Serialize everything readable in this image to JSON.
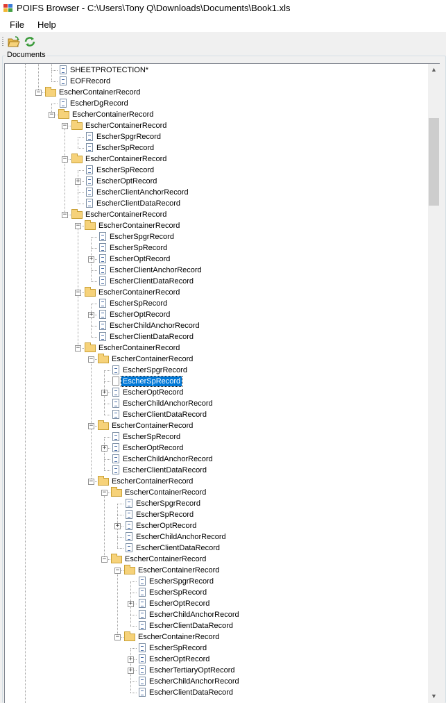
{
  "window": {
    "title": "POIFS Browser - C:\\Users\\Tony Q\\Downloads\\Documents\\Book1.xls"
  },
  "menu": {
    "file": "File",
    "help": "Help"
  },
  "toolbar": {
    "open": "open-folder-icon",
    "refresh": "refresh-icon"
  },
  "group": {
    "label": "Documents"
  },
  "tree": {
    "nodes": [
      {
        "label": "SHEETPROTECTION*",
        "depth": 3,
        "kind": "doc",
        "expander": ""
      },
      {
        "label": "EOFRecord",
        "depth": 3,
        "kind": "doc",
        "expander": ""
      },
      {
        "label": "EscherContainerRecord",
        "depth": 2,
        "kind": "folder",
        "expander": "-"
      },
      {
        "label": "EscherDgRecord",
        "depth": 3,
        "kind": "doc",
        "expander": ""
      },
      {
        "label": "EscherContainerRecord",
        "depth": 3,
        "kind": "folder",
        "expander": "-"
      },
      {
        "label": "EscherContainerRecord",
        "depth": 4,
        "kind": "folder",
        "expander": "-"
      },
      {
        "label": "EscherSpgrRecord",
        "depth": 5,
        "kind": "doc",
        "expander": ""
      },
      {
        "label": "EscherSpRecord",
        "depth": 5,
        "kind": "doc",
        "expander": ""
      },
      {
        "label": "EscherContainerRecord",
        "depth": 4,
        "kind": "folder",
        "expander": "-"
      },
      {
        "label": "EscherSpRecord",
        "depth": 5,
        "kind": "doc",
        "expander": ""
      },
      {
        "label": "EscherOptRecord",
        "depth": 5,
        "kind": "doc",
        "expander": "+"
      },
      {
        "label": "EscherClientAnchorRecord",
        "depth": 5,
        "kind": "doc",
        "expander": ""
      },
      {
        "label": "EscherClientDataRecord",
        "depth": 5,
        "kind": "doc",
        "expander": ""
      },
      {
        "label": "EscherContainerRecord",
        "depth": 4,
        "kind": "folder",
        "expander": "-"
      },
      {
        "label": "EscherContainerRecord",
        "depth": 5,
        "kind": "folder",
        "expander": "-"
      },
      {
        "label": "EscherSpgrRecord",
        "depth": 6,
        "kind": "doc",
        "expander": ""
      },
      {
        "label": "EscherSpRecord",
        "depth": 6,
        "kind": "doc",
        "expander": ""
      },
      {
        "label": "EscherOptRecord",
        "depth": 6,
        "kind": "doc",
        "expander": "+"
      },
      {
        "label": "EscherClientAnchorRecord",
        "depth": 6,
        "kind": "doc",
        "expander": ""
      },
      {
        "label": "EscherClientDataRecord",
        "depth": 6,
        "kind": "doc",
        "expander": ""
      },
      {
        "label": "EscherContainerRecord",
        "depth": 5,
        "kind": "folder",
        "expander": "-"
      },
      {
        "label": "EscherSpRecord",
        "depth": 6,
        "kind": "doc",
        "expander": ""
      },
      {
        "label": "EscherOptRecord",
        "depth": 6,
        "kind": "doc",
        "expander": "+"
      },
      {
        "label": "EscherChildAnchorRecord",
        "depth": 6,
        "kind": "doc",
        "expander": ""
      },
      {
        "label": "EscherClientDataRecord",
        "depth": 6,
        "kind": "doc",
        "expander": ""
      },
      {
        "label": "EscherContainerRecord",
        "depth": 5,
        "kind": "folder",
        "expander": "-"
      },
      {
        "label": "EscherContainerRecord",
        "depth": 6,
        "kind": "folder",
        "expander": "-"
      },
      {
        "label": "EscherSpgrRecord",
        "depth": 7,
        "kind": "doc",
        "expander": ""
      },
      {
        "label": "EscherSpRecord",
        "depth": 7,
        "kind": "docblank",
        "expander": "",
        "selected": true
      },
      {
        "label": "EscherOptRecord",
        "depth": 7,
        "kind": "doc",
        "expander": "+"
      },
      {
        "label": "EscherChildAnchorRecord",
        "depth": 7,
        "kind": "doc",
        "expander": ""
      },
      {
        "label": "EscherClientDataRecord",
        "depth": 7,
        "kind": "doc",
        "expander": ""
      },
      {
        "label": "EscherContainerRecord",
        "depth": 6,
        "kind": "folder",
        "expander": "-"
      },
      {
        "label": "EscherSpRecord",
        "depth": 7,
        "kind": "doc",
        "expander": ""
      },
      {
        "label": "EscherOptRecord",
        "depth": 7,
        "kind": "doc",
        "expander": "+"
      },
      {
        "label": "EscherChildAnchorRecord",
        "depth": 7,
        "kind": "doc",
        "expander": ""
      },
      {
        "label": "EscherClientDataRecord",
        "depth": 7,
        "kind": "doc",
        "expander": ""
      },
      {
        "label": "EscherContainerRecord",
        "depth": 6,
        "kind": "folder",
        "expander": "-"
      },
      {
        "label": "EscherContainerRecord",
        "depth": 7,
        "kind": "folder",
        "expander": "-"
      },
      {
        "label": "EscherSpgrRecord",
        "depth": 8,
        "kind": "doc",
        "expander": ""
      },
      {
        "label": "EscherSpRecord",
        "depth": 8,
        "kind": "doc",
        "expander": ""
      },
      {
        "label": "EscherOptRecord",
        "depth": 8,
        "kind": "doc",
        "expander": "+"
      },
      {
        "label": "EscherChildAnchorRecord",
        "depth": 8,
        "kind": "doc",
        "expander": ""
      },
      {
        "label": "EscherClientDataRecord",
        "depth": 8,
        "kind": "doc",
        "expander": ""
      },
      {
        "label": "EscherContainerRecord",
        "depth": 7,
        "kind": "folder",
        "expander": "-"
      },
      {
        "label": "EscherContainerRecord",
        "depth": 8,
        "kind": "folder",
        "expander": "-"
      },
      {
        "label": "EscherSpgrRecord",
        "depth": 9,
        "kind": "doc",
        "expander": ""
      },
      {
        "label": "EscherSpRecord",
        "depth": 9,
        "kind": "doc",
        "expander": ""
      },
      {
        "label": "EscherOptRecord",
        "depth": 9,
        "kind": "doc",
        "expander": "+"
      },
      {
        "label": "EscherChildAnchorRecord",
        "depth": 9,
        "kind": "doc",
        "expander": ""
      },
      {
        "label": "EscherClientDataRecord",
        "depth": 9,
        "kind": "doc",
        "expander": ""
      },
      {
        "label": "EscherContainerRecord",
        "depth": 8,
        "kind": "folder",
        "expander": "-"
      },
      {
        "label": "EscherSpRecord",
        "depth": 9,
        "kind": "doc",
        "expander": ""
      },
      {
        "label": "EscherOptRecord",
        "depth": 9,
        "kind": "doc",
        "expander": "+"
      },
      {
        "label": "EscherTertiaryOptRecord",
        "depth": 9,
        "kind": "doc",
        "expander": "+"
      },
      {
        "label": "EscherChildAnchorRecord",
        "depth": 9,
        "kind": "doc",
        "expander": ""
      },
      {
        "label": "EscherClientDataRecord",
        "depth": 9,
        "kind": "doc",
        "expander": ""
      }
    ]
  },
  "colors": {
    "selection": "#0078d7",
    "folder": "#f6d27a"
  }
}
